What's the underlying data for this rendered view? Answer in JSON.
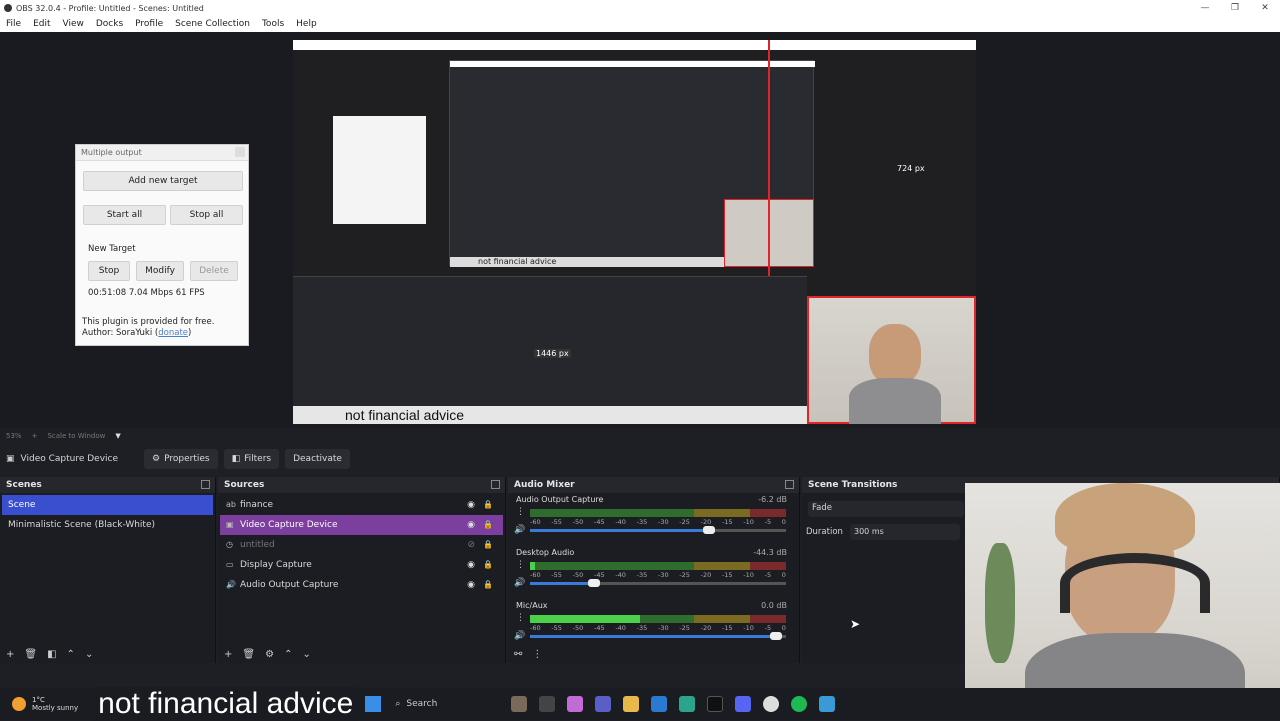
{
  "window": {
    "title": "OBS 32.0.4 - Profile: Untitled - Scenes: Untitled",
    "buttons": [
      "—",
      "❐",
      "✕"
    ]
  },
  "menu": [
    "File",
    "Edit",
    "View",
    "Docks",
    "Profile",
    "Scene Collection",
    "Tools",
    "Help"
  ],
  "preview": {
    "dim_label": "724 px",
    "dim_label2": "1446 px",
    "caption": "not financial advice",
    "inner_caption": "not financial advice",
    "inner_search": "Search"
  },
  "multi_output": {
    "title": "Multiple output",
    "add_target": "Add new target",
    "start_all": "Start all",
    "stop_all": "Stop all",
    "new_target": "New Target",
    "stop": "Stop",
    "modify": "Modify",
    "delete": "Delete",
    "stats": "00:51:08  7.04 Mbps  61 FPS",
    "note1": "This plugin is provided for free.",
    "note2": "Author: SoraYuki (",
    "donate": "donate",
    "note2_end": ")"
  },
  "status": {
    "zoom": "53%",
    "scale_mode": "Scale to Window"
  },
  "source_toolbar": {
    "source_name": "Video Capture Device",
    "properties": "Properties",
    "filters": "Filters",
    "deactivate": "Deactivate"
  },
  "scenes": {
    "title": "Scenes",
    "items": [
      "Scene",
      "Minimalistic Scene (Black-White)"
    ]
  },
  "sources": {
    "title": "Sources",
    "items": [
      "finance",
      "Video Capture Device",
      "untitled",
      "Display Capture",
      "Audio Output Capture"
    ]
  },
  "mixer": {
    "title": "Audio Mixer",
    "channels": [
      {
        "name": "Audio Output Capture",
        "db": "-6.2 dB",
        "level": 0,
        "volume": 0.7
      },
      {
        "name": "Desktop Audio",
        "db": "-44.3 dB",
        "level": 0.02,
        "volume": 0.25
      },
      {
        "name": "Mic/Aux",
        "db": "0.0 dB",
        "level": 0.43,
        "volume": 0.96
      }
    ],
    "scale": [
      "-60",
      "-55",
      "-50",
      "-45",
      "-40",
      "-35",
      "-30",
      "-25",
      "-20",
      "-15",
      "-10",
      "-5",
      "0"
    ]
  },
  "transitions": {
    "title": "Scene Transitions",
    "selected": "Fade",
    "duration_label": "Duration",
    "duration": "300 ms"
  },
  "taskbar": {
    "temp": "1°C",
    "weather": "Mostly sunny",
    "caption": "not financial advice",
    "search": "Search"
  },
  "colors": {
    "selected_scene": "#3a4ed0",
    "selected_source": "#7c3f9e",
    "panel_bg": "#1c1d22",
    "red_guide": "#e0242a"
  }
}
